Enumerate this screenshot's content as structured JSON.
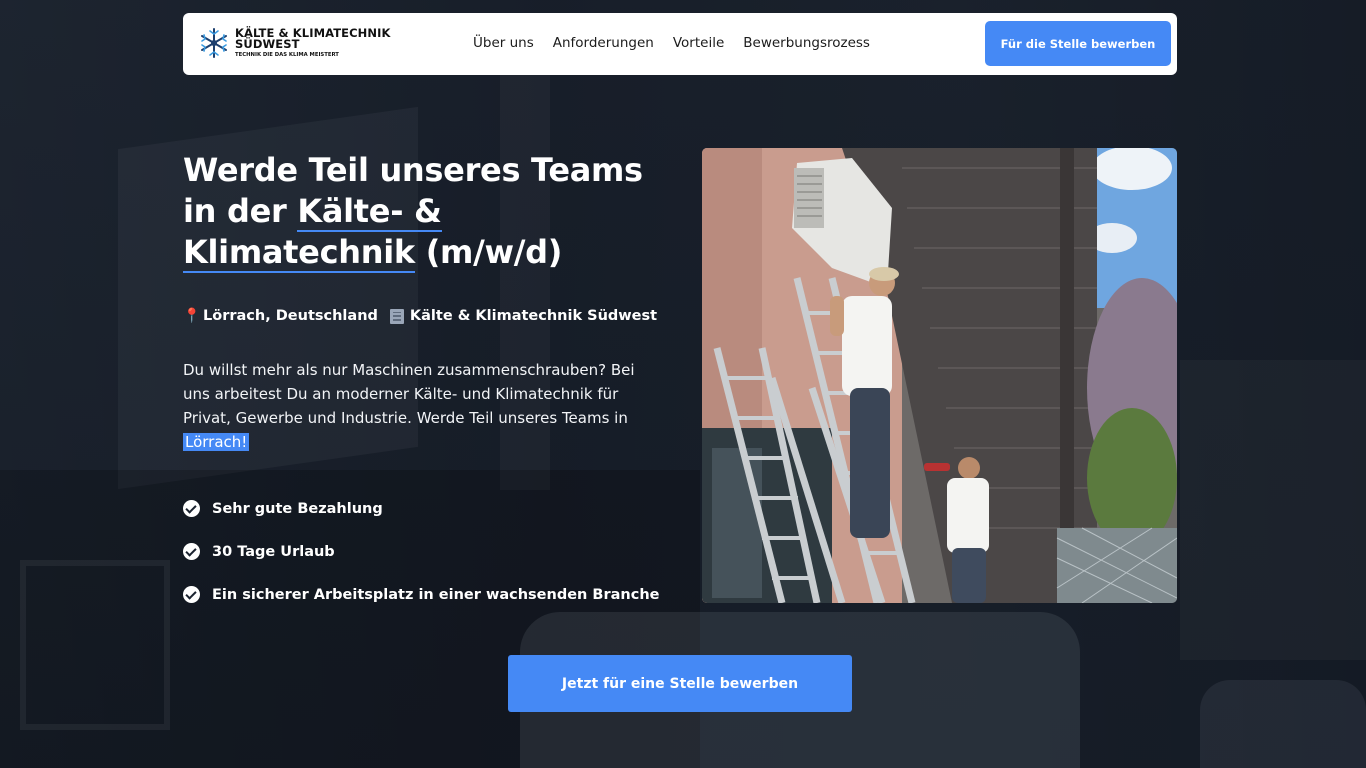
{
  "header": {
    "logo_line1": "KÄLTE & KLIMATECHNIK",
    "logo_line2": "SÜDWEST",
    "logo_tagline": "TECHNIK DIE DAS KLIMA MEISTERT",
    "nav": [
      {
        "label": "Über uns"
      },
      {
        "label": "Anforderungen"
      },
      {
        "label": "Vorteile"
      },
      {
        "label": "Bewerbungsrozess"
      }
    ],
    "cta_label": "Für die Stelle bewerben"
  },
  "hero": {
    "title_part1": "Werde Teil unseres Teams in der ",
    "title_highlight": "Kälte- & Klimatechnik",
    "title_part2": " (m/w/d)",
    "location": "Lörrach, Deutschland",
    "company": "Kälte & Klimatechnik Südwest",
    "description": "Du willst mehr als nur Maschinen zusammenschrauben? Bei uns arbeitest Du an moderner Kälte- und Klimatechnik für Privat, Gewerbe und Industrie. Werde Teil unseres Teams in ",
    "description_highlight": "Lörrach!",
    "benefits": [
      {
        "label": "Sehr gute Bezahlung"
      },
      {
        "label": "30 Tage Urlaub"
      },
      {
        "label": "Ein sicherer Arbeitsplatz in einer wachsenden Branche"
      }
    ],
    "photo_icon": "photo-two-workers-installing-ac-unit",
    "cta_label": "Jetzt für eine Stelle bewerben"
  },
  "colors": {
    "accent": "#4589f5",
    "background": "#1b2330",
    "header_bg": "#ffffff"
  }
}
